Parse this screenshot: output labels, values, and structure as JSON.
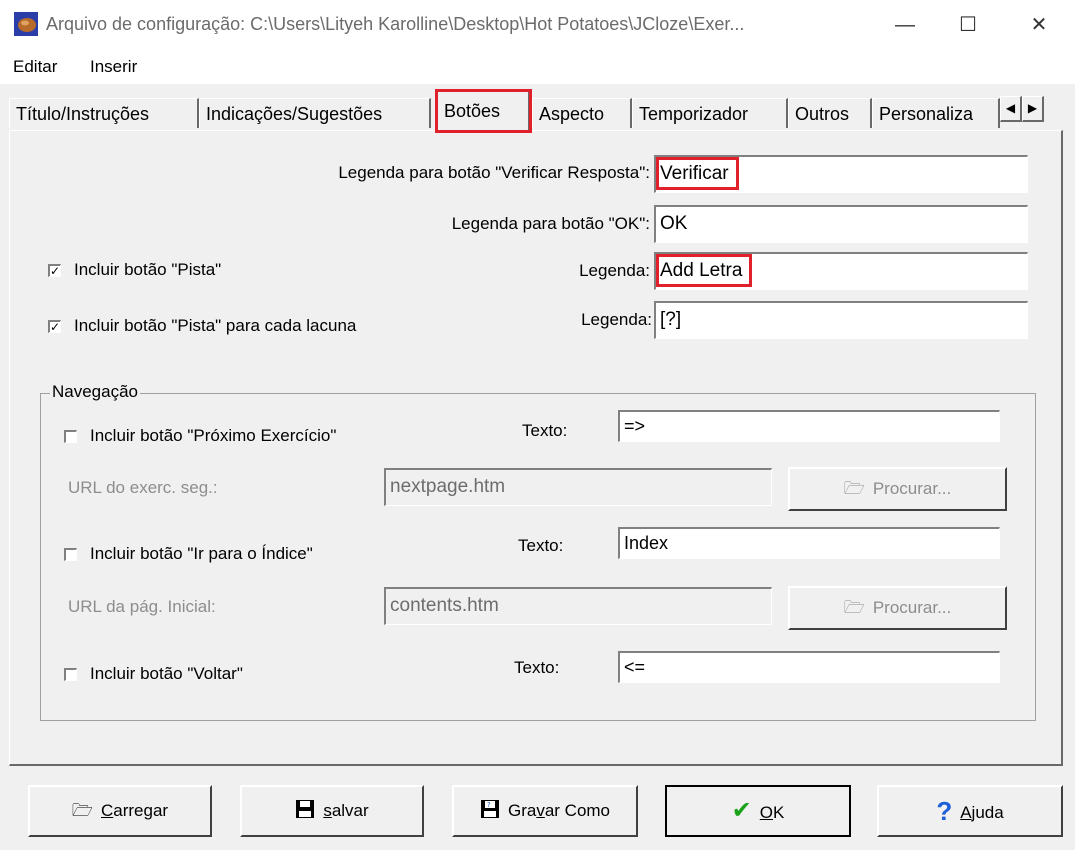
{
  "window": {
    "title": "Arquivo de configuração: C:\\Users\\Lityeh Karolline\\Desktop\\Hot Potatoes\\JCloze\\Exer...",
    "minimize_glyph": "—",
    "maximize_glyph": "☐",
    "close_glyph": "✕"
  },
  "menu": {
    "edit": "Editar",
    "insert": "Inserir"
  },
  "tabs": [
    {
      "label": "Título/Instruções"
    },
    {
      "label": "Indicações/Sugestões"
    },
    {
      "label": "Botões",
      "active": true
    },
    {
      "label": "Aspecto"
    },
    {
      "label": "Temporizador"
    },
    {
      "label": "Outros"
    },
    {
      "label": "Personaliza"
    }
  ],
  "tab_scroll": {
    "left": "◀",
    "right": "▶"
  },
  "buttons_tab": {
    "check_caption_label": "Legenda para botão \"Verificar Resposta\":",
    "check_caption_value": "Verificar",
    "ok_caption_label": "Legenda para botão \"OK\":",
    "ok_caption_value": "OK",
    "include_hint_label": "Incluir botão \"Pista\"",
    "include_hint_checked": true,
    "hint_caption_label": "Legenda:",
    "hint_caption_value": "Add Letra",
    "include_gap_hint_label": "Incluir botão \"Pista\" para cada lacuna",
    "include_gap_hint_checked": true,
    "gap_hint_caption_label": "Legenda:",
    "gap_hint_caption_value": "[?]"
  },
  "navigation": {
    "legend": "Navegação",
    "next_label": "Incluir botão \"Próximo Exercício\"",
    "next_text_label": "Texto:",
    "next_text_value": "=>",
    "next_url_label": "URL do exerc. seg.:",
    "next_url_value": "nextpage.htm",
    "browse_label": "Procurar...",
    "index_label": "Incluir botão \"Ir para o Índice\"",
    "index_text_label": "Texto:",
    "index_text_value": "Index",
    "index_url_label": "URL da pág. Inicial:",
    "index_url_value": "contents.htm",
    "back_label": "Incluir botão \"Voltar\"",
    "back_text_label": "Texto:",
    "back_text_value": "<="
  },
  "bottom_buttons": {
    "load_first": "C",
    "load_rest": "arregar",
    "save_first": "s",
    "save_rest": "alvar",
    "saveas_pre": "Gra",
    "saveas_acc": "v",
    "saveas_post": "ar Como",
    "ok_first": "O",
    "ok_rest": "K",
    "help_first": "A",
    "help_rest": "juda"
  },
  "colors": {
    "highlight": "#e0202a",
    "ok_check": "#1aa31a",
    "help_icon": "#1c5fd6"
  }
}
